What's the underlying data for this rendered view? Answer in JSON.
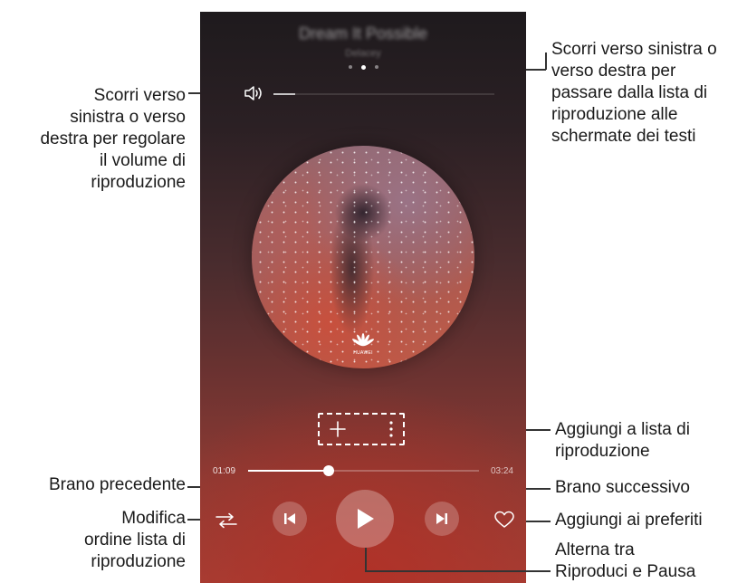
{
  "player": {
    "song_title": "Dream It Possible",
    "artist": "Delacey",
    "volume_fraction": 0.1,
    "current_time": "01:09",
    "total_time": "03:24",
    "progress_fraction": 0.35,
    "logo_text": "HUAWEI"
  },
  "annotations": {
    "volume": [
      "Scorri verso",
      "sinistra o verso",
      "destra per regolare",
      "il volume di",
      "riproduzione"
    ],
    "swipe": [
      "Scorri verso sinistra o",
      "verso destra per",
      "passare dalla lista di",
      "riproduzione alle",
      "schermate dei testi"
    ],
    "add_playlist": [
      "Aggiungi a lista di",
      "riproduzione"
    ],
    "previous": [
      "Brano precedente"
    ],
    "next": [
      "Brano successivo"
    ],
    "shuffle": [
      "Modifica",
      "ordine lista di",
      "riproduzione"
    ],
    "favorite": [
      "Aggiungi ai preferiti"
    ],
    "play_pause": [
      "Alterna tra",
      "Riproduci e Pausa"
    ]
  }
}
